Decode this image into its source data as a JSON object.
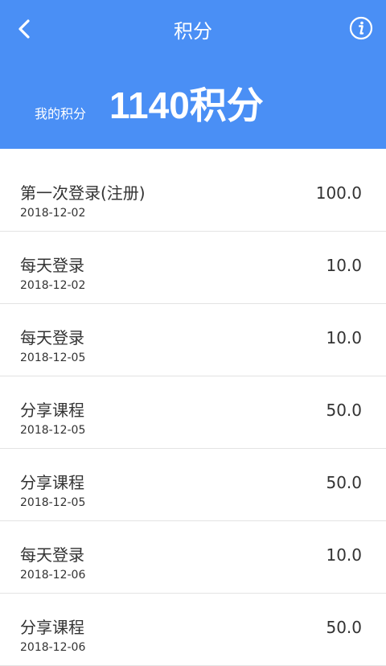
{
  "header": {
    "title": "积分",
    "points_label": "我的积分",
    "points_value": "1140积分",
    "accent_color": "#4a8ff5"
  },
  "icons": {
    "back": "chevron-left-icon",
    "info": "info-circle-icon"
  },
  "records": [
    {
      "title": "第一次登录(注册)",
      "date": "2018-12-02",
      "value": "100.0"
    },
    {
      "title": "每天登录",
      "date": "2018-12-02",
      "value": "10.0"
    },
    {
      "title": "每天登录",
      "date": "2018-12-05",
      "value": "10.0"
    },
    {
      "title": "分享课程",
      "date": "2018-12-05",
      "value": "50.0"
    },
    {
      "title": "分享课程",
      "date": "2018-12-05",
      "value": "50.0"
    },
    {
      "title": "每天登录",
      "date": "2018-12-06",
      "value": "10.0"
    },
    {
      "title": "分享课程",
      "date": "2018-12-06",
      "value": "50.0"
    }
  ]
}
